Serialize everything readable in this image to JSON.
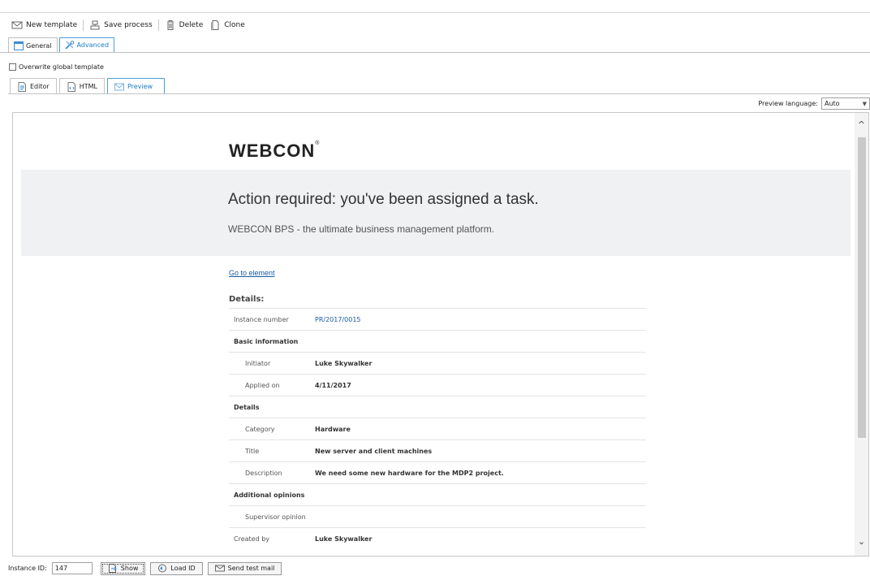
{
  "toolbar": {
    "new_template": "New template",
    "save_process": "Save process",
    "delete": "Delete",
    "clone": "Clone"
  },
  "top_tabs": [
    {
      "label": "General",
      "icon": "window-icon"
    },
    {
      "label": "Advanced",
      "icon": "tools-icon",
      "active": true
    }
  ],
  "overwrite_label": "Overwrite global template",
  "sub_tabs": [
    {
      "label": "Editor",
      "icon": "editor-doc-icon"
    },
    {
      "label": "HTML",
      "icon": "html-doc-icon"
    },
    {
      "label": "Preview",
      "icon": "preview-mail-icon",
      "active": true
    }
  ],
  "preview_language": {
    "label": "Preview language:",
    "value": "Auto"
  },
  "preview": {
    "logo": "WEBCON",
    "banner_title": "Action required: you've been assigned a task.",
    "banner_subtitle": "WEBCON BPS - the ultimate business management platform.",
    "goto_link": "Go to element",
    "details_heading": "Details:",
    "rows": [
      {
        "type": "top",
        "label": "Instance number",
        "value": "PR/2017/0015"
      },
      {
        "type": "section",
        "label": "Basic information",
        "value": ""
      },
      {
        "type": "sub",
        "label": "Initiator",
        "value": "Luke Skywalker"
      },
      {
        "type": "sub",
        "label": "Applied on",
        "value": "4/11/2017"
      },
      {
        "type": "section",
        "label": "Details",
        "value": ""
      },
      {
        "type": "sub",
        "label": "Category",
        "value": "Hardware"
      },
      {
        "type": "sub",
        "label": "Title",
        "value": "New server and client machines"
      },
      {
        "type": "sub",
        "label": "Description",
        "value": "We need some new hardware for the MDP2 project."
      },
      {
        "type": "section",
        "label": "Additional opinions",
        "value": ""
      },
      {
        "type": "sub",
        "label": "Supervisor opinion",
        "value": ""
      },
      {
        "type": "top",
        "label": "Created by",
        "value": "Luke Skywalker"
      }
    ]
  },
  "bottom": {
    "instance_label": "Instance ID:",
    "instance_value": "147",
    "show": "Show",
    "load_id": "Load ID",
    "send_test_mail": "Send test mail"
  },
  "colors": {
    "accent": "#1a7cc5",
    "link": "#1a5aa6",
    "banner_bg": "#f0f1f2"
  }
}
